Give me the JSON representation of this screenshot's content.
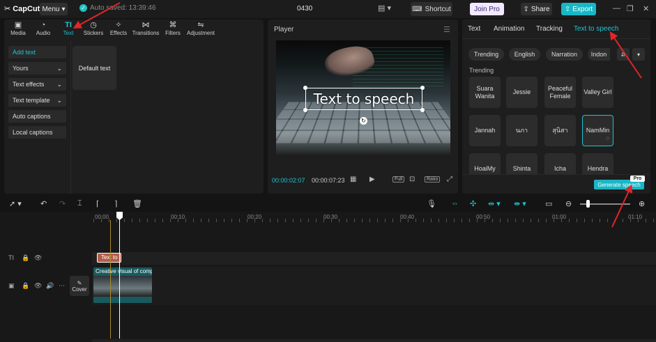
{
  "titlebar": {
    "logo": "CapCut",
    "menu_label": "Menu",
    "autosave_text": "Auto saved: 13:39:46",
    "project_title": "0430",
    "shortcut_label": "Shortcut",
    "joinpro_label": "Join Pro",
    "share_label": "Share",
    "export_label": "Export"
  },
  "left_panel": {
    "tabs": [
      {
        "label": "Media",
        "icon": "media-icon"
      },
      {
        "label": "Audio",
        "icon": "audio-icon"
      },
      {
        "label": "Text",
        "icon": "text-icon",
        "active": true
      },
      {
        "label": "Stickers",
        "icon": "stickers-icon"
      },
      {
        "label": "Effects",
        "icon": "effects-icon"
      },
      {
        "label": "Transitions",
        "icon": "transitions-icon"
      },
      {
        "label": "Filters",
        "icon": "filters-icon"
      },
      {
        "label": "Adjustment",
        "icon": "adjustment-icon"
      }
    ],
    "side_items": [
      {
        "label": "Add text",
        "active": true,
        "chevron": false
      },
      {
        "label": "Yours",
        "chevron": true
      },
      {
        "label": "Text effects",
        "chevron": true
      },
      {
        "label": "Text template",
        "chevron": true
      },
      {
        "label": "Auto captions",
        "chevron": false
      },
      {
        "label": "Local captions",
        "chevron": false
      }
    ],
    "default_text_card": "Default text"
  },
  "player": {
    "title": "Player",
    "overlay_text": "Text to speech",
    "current_time": "00:00:02:07",
    "duration": "00:00:07:23",
    "full_label": "Full",
    "ratio_label": "Ratio"
  },
  "right_panel": {
    "tabs": [
      "Text",
      "Animation",
      "Tracking",
      "Text to speech"
    ],
    "active_tab": "Text to speech",
    "chips": [
      "Trending",
      "English",
      "Narration",
      "Indon"
    ],
    "section_label": "Trending",
    "voices": [
      [
        "Suara Wanita",
        "Jessie",
        "Peaceful Female",
        "Valley Girl"
      ],
      [
        "Jannah",
        "นภา",
        "สุนิสา",
        "NamMin"
      ],
      [
        "HoaiMy",
        "Shinta",
        "Icha",
        "Hendra"
      ]
    ],
    "selected_voice": "NamMin",
    "generate_label": "Generate speech",
    "pro_badge": "Pro"
  },
  "timeline": {
    "ruler_labels": [
      "00:00",
      "00:10",
      "00:20",
      "00:30",
      "00:40",
      "00:50",
      "01:00",
      "01:10"
    ],
    "text_clip_label": "Text to",
    "video_clip_label": "Creative visual of compu",
    "cover_label": "Cover"
  },
  "colors": {
    "accent": "#1fc3d3",
    "background": "#141414",
    "panel": "#1e1e1e",
    "text_clip": "#b35c47",
    "video_clip": "#195a5e",
    "arrow": "#e0262b"
  }
}
